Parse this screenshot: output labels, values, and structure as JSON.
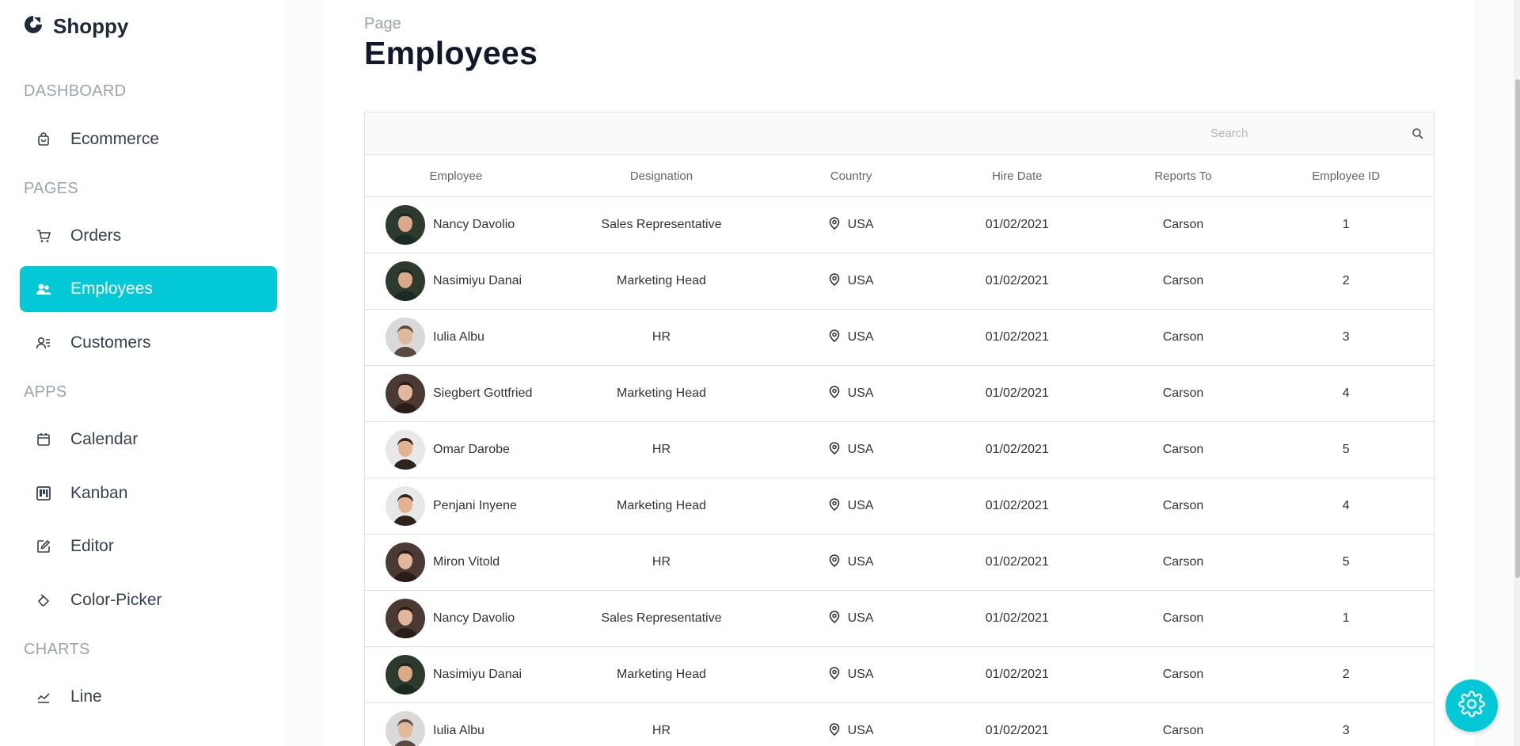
{
  "brand": {
    "name": "Shoppy"
  },
  "sidebar": {
    "sections": [
      {
        "label": "DASHBOARD",
        "items": [
          {
            "label": "Ecommerce",
            "icon": "bag-icon"
          }
        ]
      },
      {
        "label": "PAGES",
        "items": [
          {
            "label": "Orders",
            "icon": "cart-icon"
          },
          {
            "label": "Employees",
            "icon": "employees-icon",
            "active": true
          },
          {
            "label": "Customers",
            "icon": "customers-icon"
          }
        ]
      },
      {
        "label": "APPS",
        "items": [
          {
            "label": "Calendar",
            "icon": "calendar-icon"
          },
          {
            "label": "Kanban",
            "icon": "kanban-icon"
          },
          {
            "label": "Editor",
            "icon": "edit-icon"
          },
          {
            "label": "Color-Picker",
            "icon": "color-picker-icon"
          }
        ]
      },
      {
        "label": "CHARTS",
        "items": [
          {
            "label": "Line",
            "icon": "line-chart-icon"
          }
        ]
      }
    ]
  },
  "header": {
    "crumb": "Page",
    "title": "Employees"
  },
  "search": {
    "placeholder": "Search"
  },
  "table": {
    "columns": [
      "Employee",
      "Designation",
      "Country",
      "Hire Date",
      "Reports To",
      "Employee ID"
    ],
    "rows": [
      {
        "name": "Nancy Davolio",
        "designation": "Sales Representative",
        "country": "USA",
        "hire_date": "01/02/2021",
        "reports_to": "Carson",
        "id": "1"
      },
      {
        "name": "Nasimiyu Danai",
        "designation": "Marketing Head",
        "country": "USA",
        "hire_date": "01/02/2021",
        "reports_to": "Carson",
        "id": "2"
      },
      {
        "name": "Iulia Albu",
        "designation": "HR",
        "country": "USA",
        "hire_date": "01/02/2021",
        "reports_to": "Carson",
        "id": "3"
      },
      {
        "name": "Siegbert Gottfried",
        "designation": "Marketing Head",
        "country": "USA",
        "hire_date": "01/02/2021",
        "reports_to": "Carson",
        "id": "4"
      },
      {
        "name": "Omar Darobe",
        "designation": "HR",
        "country": "USA",
        "hire_date": "01/02/2021",
        "reports_to": "Carson",
        "id": "5"
      },
      {
        "name": "Penjani Inyene",
        "designation": "Marketing Head",
        "country": "USA",
        "hire_date": "01/02/2021",
        "reports_to": "Carson",
        "id": "4"
      },
      {
        "name": "Miron Vitold",
        "designation": "HR",
        "country": "USA",
        "hire_date": "01/02/2021",
        "reports_to": "Carson",
        "id": "5"
      },
      {
        "name": "Nancy Davolio",
        "designation": "Sales Representative",
        "country": "USA",
        "hire_date": "01/02/2021",
        "reports_to": "Carson",
        "id": "1"
      },
      {
        "name": "Nasimiyu Danai",
        "designation": "Marketing Head",
        "country": "USA",
        "hire_date": "01/02/2021",
        "reports_to": "Carson",
        "id": "2"
      },
      {
        "name": "Iulia Albu",
        "designation": "HR",
        "country": "USA",
        "hire_date": "01/02/2021",
        "reports_to": "Carson",
        "id": "3"
      }
    ]
  },
  "colors": {
    "accent": "#03c9d7",
    "sidebar_bg": "#ffffff",
    "page_bg": "#fafbfb"
  }
}
